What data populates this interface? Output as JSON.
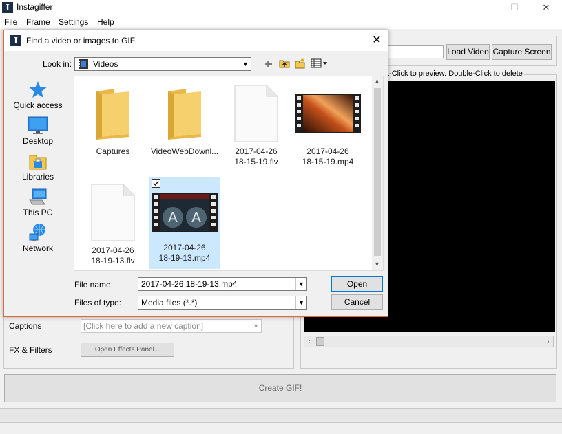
{
  "app": {
    "title": "Instagiffer",
    "menu": [
      "File",
      "Frame",
      "Settings",
      "Help"
    ],
    "load_video_label": "Load Video",
    "capture_screen_label": "Capture Screen",
    "preview_hint": "t-Click to preview. Double-Click to delete",
    "captions_label": "Captions",
    "caption_placeholder": "[Click here to add a new caption]",
    "fx_label": "FX & Filters",
    "effects_button_label": "Open Effects Panel...",
    "create_gif_label": "Create GIF!",
    "window_controls": {
      "minimize": "—",
      "maximize": "☐",
      "close": "✕"
    }
  },
  "dialog": {
    "title": "Find a video or images to GIF",
    "close_glyph": "✕",
    "look_in_label": "Look in:",
    "look_in_value": "Videos",
    "places": [
      {
        "label": "Quick access",
        "icon": "quick-access-star-icon"
      },
      {
        "label": "Desktop",
        "icon": "desktop-icon"
      },
      {
        "label": "Libraries",
        "icon": "libraries-icon"
      },
      {
        "label": "This PC",
        "icon": "this-pc-icon"
      },
      {
        "label": "Network",
        "icon": "network-icon"
      }
    ],
    "files": [
      {
        "name": "Captures",
        "kind": "folder",
        "selected": false
      },
      {
        "name": "VideoWebDownl...",
        "kind": "folder",
        "selected": false
      },
      {
        "name": "2017-04-26\n18-15-19.flv",
        "kind": "blank",
        "selected": false
      },
      {
        "name": "2017-04-26\n18-15-19.mp4",
        "kind": "video",
        "selected": false
      },
      {
        "name": "2017-04-26\n18-19-13.flv",
        "kind": "blank",
        "selected": false
      },
      {
        "name": "2017-04-26\n18-19-13.mp4",
        "kind": "video",
        "selected": true
      }
    ],
    "file_name_label": "File name:",
    "file_name_value": "2017-04-26 18-19-13.mp4",
    "file_type_label": "Files of type:",
    "file_type_value": "Media files (*.*)",
    "open_label": "Open",
    "cancel_label": "Cancel"
  },
  "colors": {
    "dialog_border": "#e06a3b",
    "selection": "#cce8ff",
    "folder": "#f2c94c",
    "preview_bg": "#000000"
  }
}
